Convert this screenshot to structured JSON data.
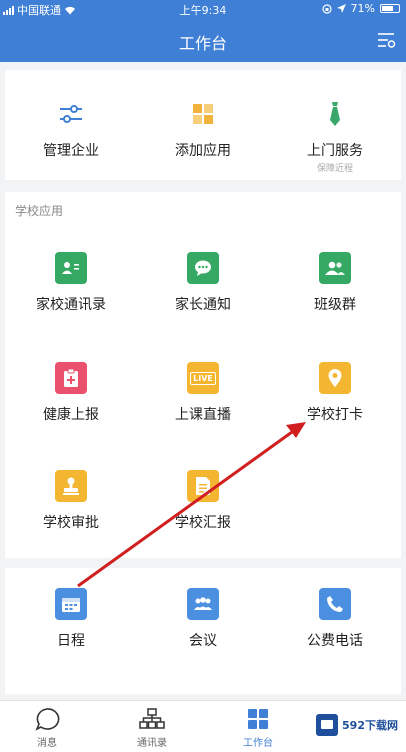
{
  "status_bar": {
    "carrier": "中国联通",
    "time": "上午9:34",
    "battery": "71%",
    "battery_level": 0.71
  },
  "header": {
    "title": "工作台",
    "menu_icon": "settings-list-icon"
  },
  "top_row": [
    {
      "label": "管理企业",
      "icon": "sliders-icon",
      "color": "#3f7fd6"
    },
    {
      "label": "添加应用",
      "icon": "grid-add-icon",
      "color": "#f2b33d"
    },
    {
      "label": "上门服务",
      "sub": "保障近程",
      "icon": "tie-icon",
      "color": "#39a66a"
    }
  ],
  "school_section": {
    "title": "学校应用"
  },
  "school_apps": [
    {
      "label": "家校通讯录",
      "icon": "contact-card-icon",
      "color": "#35a863"
    },
    {
      "label": "家长通知",
      "icon": "chat-bubble-icon",
      "color": "#35a863"
    },
    {
      "label": "班级群",
      "icon": "group-icon",
      "color": "#35a863"
    },
    {
      "label": "健康上报",
      "icon": "medical-clipboard-icon",
      "color": "#e9516c"
    },
    {
      "label": "上课直播",
      "icon": "live-icon",
      "color": "#f4b531",
      "badge": "LIVE"
    },
    {
      "label": "学校打卡",
      "icon": "location-pin-icon",
      "color": "#f4b531"
    },
    {
      "label": "学校审批",
      "icon": "stamp-icon",
      "color": "#f4b531"
    },
    {
      "label": "学校汇报",
      "icon": "document-icon",
      "color": "#f4b531"
    }
  ],
  "misc_apps": [
    {
      "label": "日程",
      "icon": "calendar-icon",
      "color": "#4a8fe0"
    },
    {
      "label": "会议",
      "icon": "meeting-icon",
      "color": "#4a8fe0"
    },
    {
      "label": "公费电话",
      "icon": "phone-icon",
      "color": "#4a8fe0"
    }
  ],
  "tabbar": [
    {
      "label": "消息",
      "icon": "message-icon"
    },
    {
      "label": "通讯录",
      "icon": "org-chart-icon"
    },
    {
      "label": "工作台",
      "icon": "workbench-icon",
      "active": true
    }
  ],
  "watermark": {
    "text": "592下载网"
  }
}
